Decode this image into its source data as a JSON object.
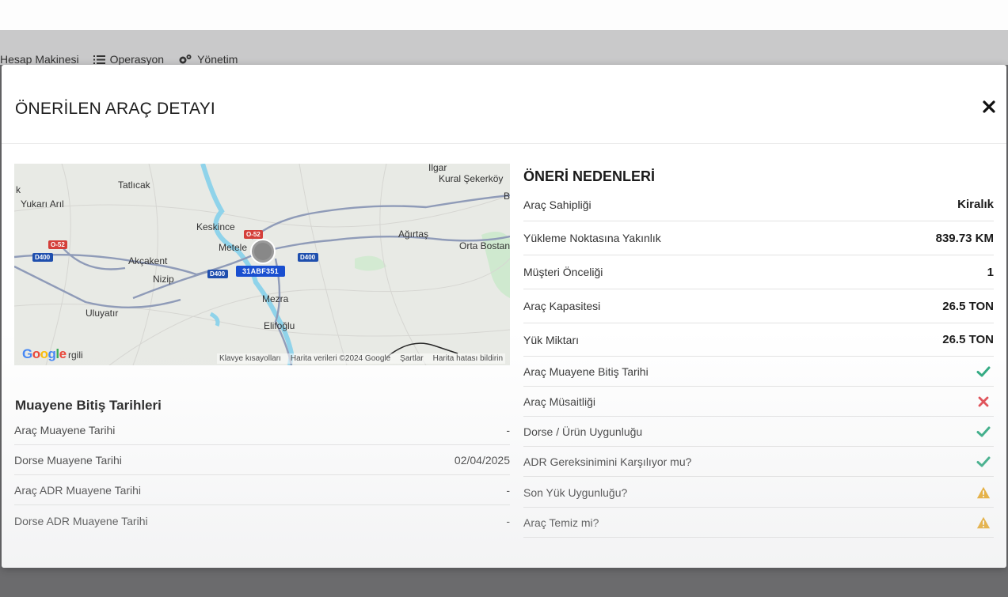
{
  "nav": {
    "items": [
      {
        "label": "Hesap Makinesi",
        "icon": "none"
      },
      {
        "label": "Operasyon",
        "icon": "list-icon"
      },
      {
        "label": "Yönetim",
        "icon": "gears-icon"
      }
    ]
  },
  "modal": {
    "title": "ÖNERİLEN ARAÇ DETAYI",
    "close_icon": "close-icon"
  },
  "map": {
    "plate": "31ABF351",
    "labels": [
      {
        "text": "Tatlıcak"
      },
      {
        "text": "Yukarı Arıl"
      },
      {
        "text": "Keskince"
      },
      {
        "text": "Metele"
      },
      {
        "text": "Akçakent"
      },
      {
        "text": "Nizip"
      },
      {
        "text": "Uluyatır"
      },
      {
        "text": "Mezra"
      },
      {
        "text": "Elifoğlu"
      },
      {
        "text": "Ağırtaş"
      },
      {
        "text": "Orta Bostan"
      },
      {
        "text": "Kural Şekerköy"
      },
      {
        "text": "Ilgar"
      },
      {
        "text": "k"
      },
      {
        "text": "B"
      },
      {
        "text": "rgili"
      }
    ],
    "road_labels": [
      "O-52",
      "D400",
      "O-52",
      "D400",
      "D400"
    ],
    "logo": "Google",
    "attribution": [
      "Klavye kısayolları",
      "Harita verileri ©2024 Google",
      "Şartlar",
      "Harita hatası bildirin"
    ]
  },
  "inspection": {
    "title": "Muayene Bitiş Tarihleri",
    "rows": [
      {
        "label": "Araç Muayene Tarihi",
        "value": "-"
      },
      {
        "label": "Dorse Muayene Tarihi",
        "value": "02/04/2025"
      },
      {
        "label": "Araç ADR Muayene Tarihi",
        "value": "-"
      },
      {
        "label": "Dorse ADR Muayene Tarihi",
        "value": "-"
      }
    ]
  },
  "reasons": {
    "title": "ÖNERİ NEDENLERİ",
    "value_rows": [
      {
        "label": "Araç Sahipliği",
        "value": "Kiralık"
      },
      {
        "label": "Yükleme Noktasına Yakınlık",
        "value": "839.73 KM"
      },
      {
        "label": "Müşteri Önceliği",
        "value": "1"
      },
      {
        "label": "Araç Kapasitesi",
        "value": "26.5 TON"
      },
      {
        "label": "Yük Miktarı",
        "value": "26.5 TON"
      }
    ],
    "status_rows": [
      {
        "label": "Araç Muayene Bitiş Tarihi",
        "status": "check"
      },
      {
        "label": "Araç Müsaitliği",
        "status": "cross"
      },
      {
        "label": "Dorse / Ürün Uygunluğu",
        "status": "check"
      },
      {
        "label": "ADR Gereksinimini Karşılıyor mu?",
        "status": "check"
      },
      {
        "label": "Son Yük Uygunluğu?",
        "status": "warning"
      },
      {
        "label": "Araç Temiz mi?",
        "status": "warning"
      }
    ]
  },
  "colors": {
    "check": "#2aa87e",
    "cross": "#e0444c",
    "warning": "#e8a419",
    "plate": "#1a4fd0",
    "road": "#8f9bb8",
    "river": "#8fd3ea"
  }
}
